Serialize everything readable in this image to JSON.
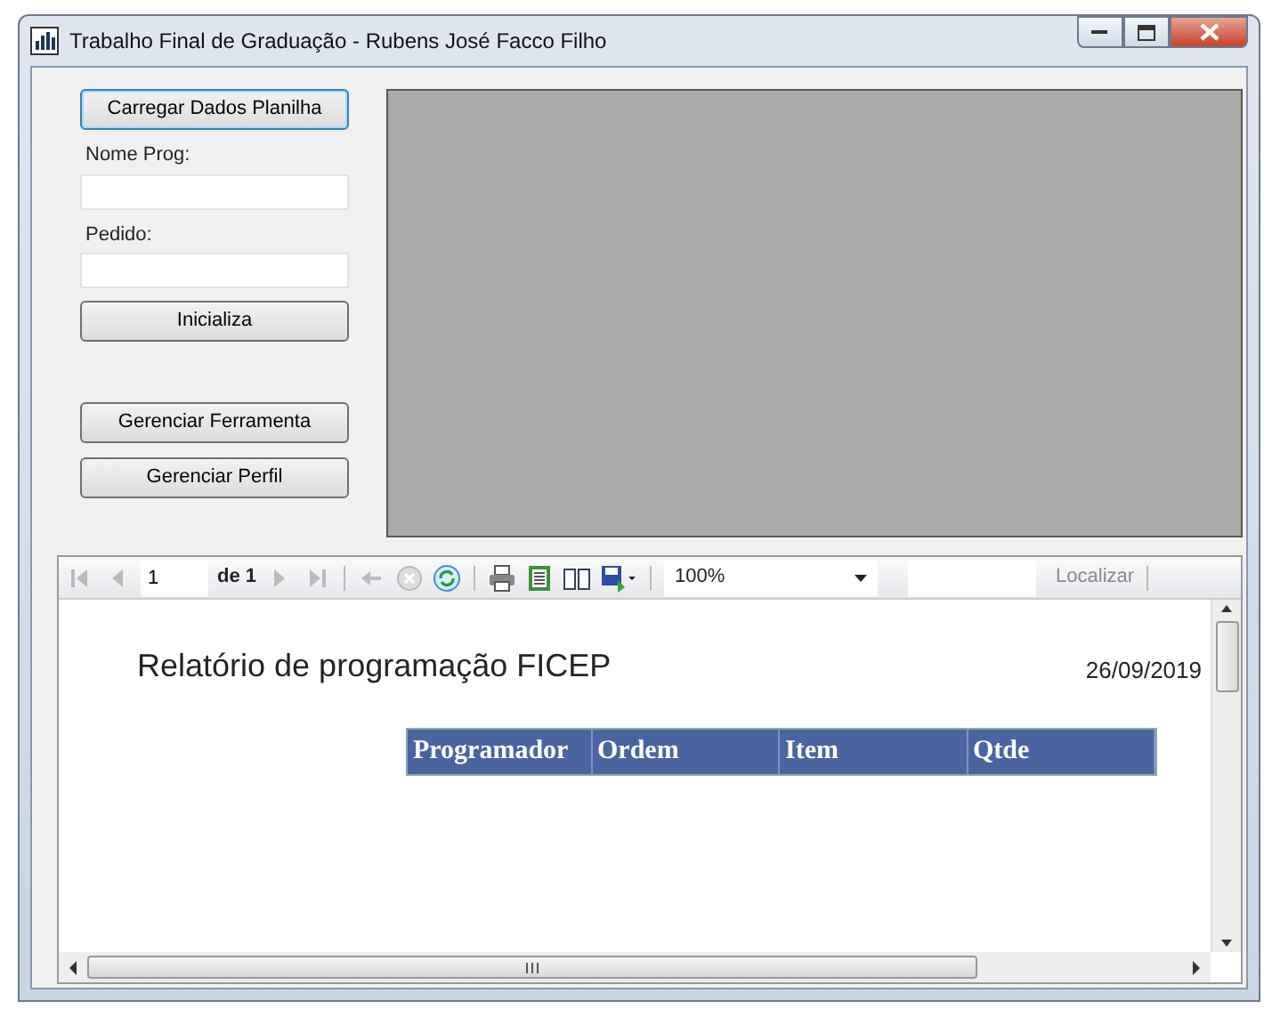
{
  "window": {
    "title": "Trabalho Final de Graduação - Rubens José Facco Filho"
  },
  "left_panel": {
    "load_button": "Carregar Dados Planilha",
    "fields": [
      {
        "label": "Nome Prog:"
      },
      {
        "label": "Pedido:"
      }
    ],
    "buttons_top": [
      "Inicializa"
    ],
    "buttons_bottom": [
      "Gerenciar Ferramenta",
      "Gerenciar Perfil"
    ]
  },
  "report_viewer": {
    "toolbar": {
      "page": "1",
      "page_of": "de 1",
      "zoom": "100%",
      "find": "Localizar"
    },
    "report": {
      "title": "Relatório de programação FICEP",
      "date": "26/09/2019",
      "columns": [
        "Programador",
        "Ordem",
        "Item",
        "Qtde"
      ]
    }
  }
}
